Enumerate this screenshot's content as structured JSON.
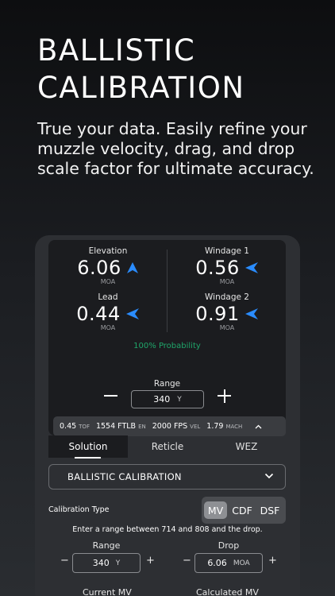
{
  "header": {
    "title": "BALLISTIC CALIBRATION",
    "subtitle": "True your data. Easily refine your muzzle velocity, drag, and drop scale factor for ultimate accuracy."
  },
  "solution": {
    "elevation": {
      "label": "Elevation",
      "value": "6.06",
      "unit": "MOA"
    },
    "windage1": {
      "label": "Windage 1",
      "value": "0.56",
      "unit": "MOA"
    },
    "lead": {
      "label": "Lead",
      "value": "0.44",
      "unit": "MOA"
    },
    "windage2": {
      "label": "Windage 2",
      "value": "0.91",
      "unit": "MOA"
    },
    "probability": "100% Probability",
    "range_label": "Range",
    "range_value": "340",
    "range_unit": "Y",
    "stats": [
      {
        "value": "0.45",
        "unit": "TOF"
      },
      {
        "value": "1554 FTLB",
        "unit": "EN"
      },
      {
        "value": "2000 FPS",
        "unit": "VEL"
      },
      {
        "value": "1.79",
        "unit": "MACH"
      }
    ],
    "accent_color": "#2a8cff",
    "probability_color": "#1fa66a"
  },
  "tabs": [
    {
      "label": "Solution",
      "active": true
    },
    {
      "label": "Reticle",
      "active": false
    },
    {
      "label": "WEZ",
      "active": false
    }
  ],
  "dropdown": {
    "value": "BALLISTIC CALIBRATION"
  },
  "calibration": {
    "type_label": "Calibration Type",
    "options": [
      "MV",
      "CDF",
      "DSF"
    ],
    "selected": "MV",
    "instruction": "Enter a range between 714 and 808 and the drop.",
    "range": {
      "label": "Range",
      "value": "340",
      "unit": "Y"
    },
    "drop": {
      "label": "Drop",
      "value": "6.06",
      "unit": "MOA"
    },
    "current_mv_label": "Current MV",
    "calculated_mv_label": "Calculated MV"
  }
}
